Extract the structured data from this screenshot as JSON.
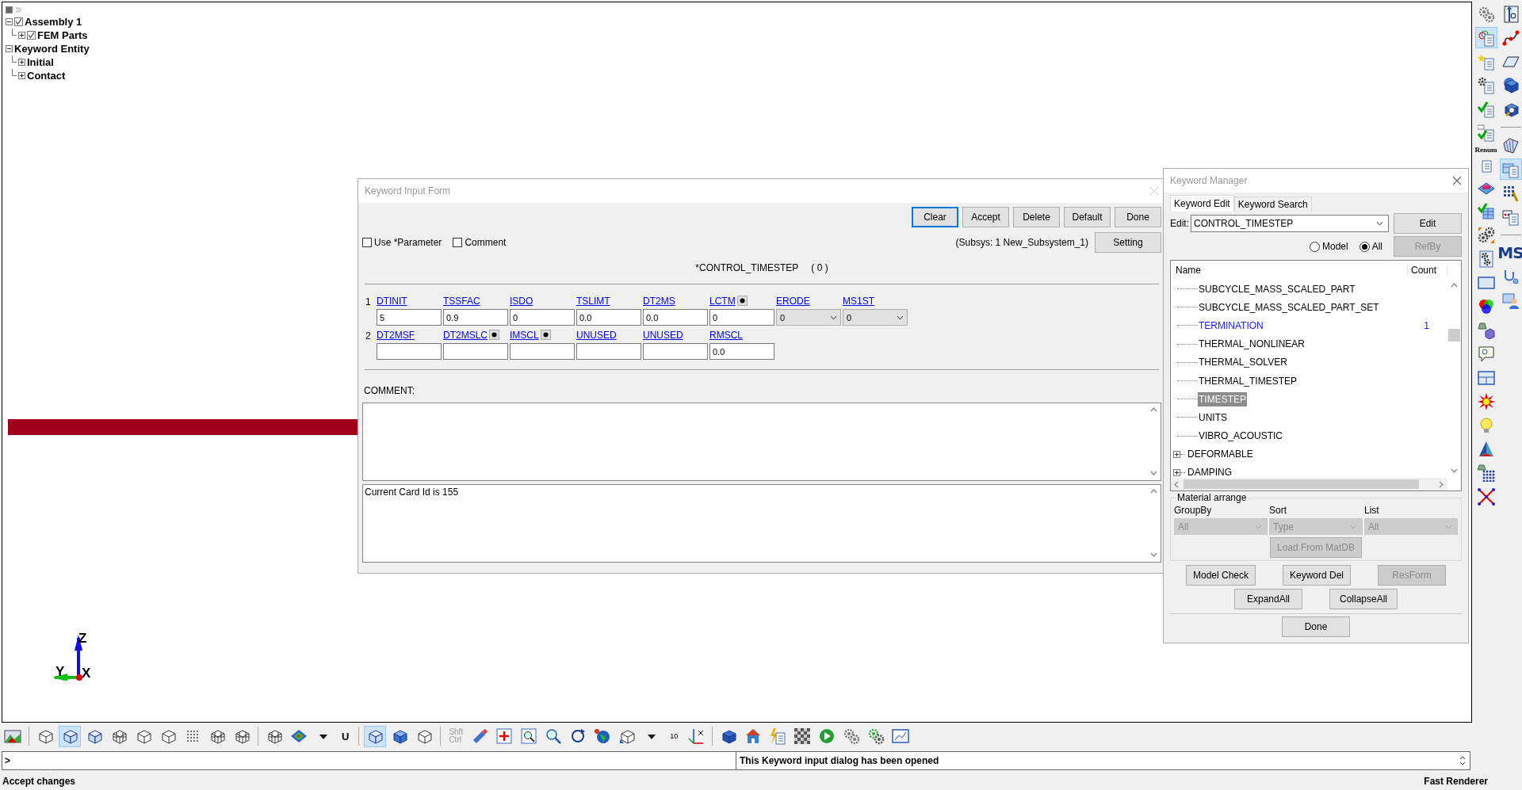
{
  "tree": [
    {
      "label": "Assembly 1",
      "checked": true,
      "expanded": true,
      "children": [
        {
          "label": "FEM Parts",
          "checked": true,
          "expanded": false
        }
      ]
    },
    {
      "label": "Keyword Entity",
      "expanded": true,
      "children": [
        {
          "label": "Initial",
          "expanded": false
        },
        {
          "label": "Contact",
          "expanded": false
        }
      ]
    }
  ],
  "axes": {
    "z": "Z",
    "y": "Y",
    "x": "X"
  },
  "input_form": {
    "title": "Keyword Input Form",
    "buttons": [
      {
        "label": "Clear",
        "focused": true
      },
      {
        "label": "Accept",
        "focused": false
      },
      {
        "label": "Delete",
        "focused": false
      },
      {
        "label": "Default",
        "focused": false
      },
      {
        "label": "Done",
        "focused": false
      }
    ],
    "options": [
      {
        "label": "Use *Parameter",
        "checked": false
      },
      {
        "label": "Comment",
        "checked": false
      }
    ],
    "subsystem": "(Subsys: 1 New_Subsystem_1)",
    "setting_button": "Setting",
    "keyword": "*CONTROL_TIMESTEP",
    "count": "( 0 )",
    "cards": [
      {
        "number": "1",
        "fields": [
          {
            "name": "DTINIT",
            "kind": "text",
            "value": "5"
          },
          {
            "name": "TSSFAC",
            "kind": "text",
            "value": "0.9"
          },
          {
            "name": "ISDO",
            "kind": "text",
            "value": "0"
          },
          {
            "name": "TSLIMT",
            "kind": "text",
            "value": "0.0"
          },
          {
            "name": "DT2MS",
            "kind": "text",
            "value": "0.0"
          },
          {
            "name": "LCTM",
            "kind": "text",
            "value": "0",
            "picker": true
          },
          {
            "name": "ERODE",
            "kind": "select",
            "value": "0"
          },
          {
            "name": "MS1ST",
            "kind": "select",
            "value": "0"
          }
        ]
      },
      {
        "number": "2",
        "fields": [
          {
            "name": "DT2MSF",
            "kind": "text"
          },
          {
            "name": "DT2MSLC",
            "kind": "text",
            "picker": true
          },
          {
            "name": "IMSCL",
            "kind": "text",
            "picker": true
          },
          {
            "name": "UNUSED",
            "kind": "text"
          },
          {
            "name": "UNUSED",
            "kind": "text"
          },
          {
            "name": "RMSCL",
            "kind": "text",
            "value": "0.0"
          }
        ]
      }
    ],
    "comment_label": "COMMENT:",
    "message": "Current Card Id is 155"
  },
  "keyword_manager": {
    "title": "Keyword Manager",
    "tabs": [
      {
        "label": "Keyword Edit",
        "selected": true
      },
      {
        "label": "Keyword Search",
        "selected": false
      }
    ],
    "edit_label": "Edit:",
    "edit_value": "CONTROL_TIMESTEP",
    "edit_button": "Edit",
    "radios": [
      {
        "label": "Model",
        "selected": false
      },
      {
        "label": "All",
        "selected": true
      }
    ],
    "refby_button": {
      "label": "RefBy",
      "disabled": true
    },
    "columns": [
      "Name",
      "Count"
    ],
    "rows": [
      {
        "kind": "leaf",
        "label": "SUBCYCLE_MASS_SCALED_PART",
        "used": false,
        "selected": false
      },
      {
        "kind": "leaf",
        "label": "SUBCYCLE_MASS_SCALED_PART_SET",
        "used": false,
        "selected": false
      },
      {
        "kind": "leaf",
        "label": "TERMINATION",
        "count": "1",
        "used": true,
        "selected": false
      },
      {
        "kind": "leaf",
        "label": "THERMAL_NONLINEAR",
        "used": false,
        "selected": false
      },
      {
        "kind": "leaf",
        "label": "THERMAL_SOLVER",
        "used": false,
        "selected": false
      },
      {
        "kind": "leaf",
        "label": "THERMAL_TIMESTEP",
        "used": false,
        "selected": false
      },
      {
        "kind": "leaf",
        "label": "TIMESTEP",
        "used": false,
        "selected": true
      },
      {
        "kind": "leaf",
        "label": "UNITS",
        "used": false,
        "selected": false
      },
      {
        "kind": "leaf",
        "label": "VIBRO_ACOUSTIC",
        "used": false,
        "selected": false
      },
      {
        "kind": "group",
        "label": "DEFORMABLE",
        "used": false,
        "selected": false
      },
      {
        "kind": "group",
        "label": "DAMPING",
        "used": false,
        "selected": false
      }
    ],
    "material_arrange": {
      "title": "Material arrange",
      "selects": [
        {
          "label": "GroupBy",
          "value": "All",
          "disabled": true
        },
        {
          "label": "Sort",
          "value": "Type",
          "disabled": true
        },
        {
          "label": "List",
          "value": "All",
          "disabled": true
        }
      ],
      "load_button": {
        "label": "Load From MatDB",
        "disabled": true
      }
    },
    "buttons": [
      {
        "label": "Model Check",
        "disabled": false
      },
      {
        "label": "Keyword Del",
        "disabled": false
      },
      {
        "label": "ResForm",
        "disabled": true
      },
      {
        "label": "ExpandAll",
        "disabled": false
      },
      {
        "label": "CollapseAll",
        "disabled": false
      }
    ],
    "done_button": "Done"
  },
  "side_toolbar": {
    "column_1": [
      {
        "kind": "tool",
        "selected": false
      },
      {
        "kind": "tool",
        "selected": true
      },
      {
        "kind": "tool",
        "selected": false
      },
      {
        "kind": "tool",
        "selected": false
      },
      {
        "kind": "tool",
        "selected": false
      },
      {
        "kind": "tool",
        "selected": false
      },
      {
        "kind": "label",
        "label": "Renum"
      },
      {
        "kind": "tool",
        "selected": false
      },
      {
        "kind": "tool",
        "selected": false
      },
      {
        "kind": "tool",
        "selected": false
      },
      {
        "kind": "tool",
        "selected": false
      },
      {
        "kind": "tool",
        "selected": false
      },
      {
        "kind": "tool",
        "selected": false
      },
      {
        "kind": "tool",
        "selected": false
      },
      {
        "kind": "tool",
        "selected": false
      },
      {
        "kind": "tool",
        "selected": false
      },
      {
        "kind": "tool",
        "selected": false
      },
      {
        "kind": "tool",
        "selected": false
      },
      {
        "kind": "tool",
        "selected": false
      },
      {
        "kind": "tool",
        "selected": false
      },
      {
        "kind": "tool",
        "selected": false
      },
      {
        "kind": "tool",
        "selected": false
      }
    ],
    "column_2": [
      {
        "kind": "tool",
        "selected": false
      },
      {
        "kind": "tool",
        "selected": false
      },
      {
        "kind": "tool",
        "selected": false
      },
      {
        "kind": "tool",
        "selected": false
      },
      {
        "kind": "tool",
        "selected": false
      },
      {
        "kind": "separator"
      },
      {
        "kind": "tool",
        "selected": false
      },
      {
        "kind": "tool",
        "selected": true
      },
      {
        "kind": "tool",
        "selected": false
      },
      {
        "kind": "tool",
        "selected": false
      },
      {
        "kind": "separator"
      },
      {
        "kind": "label",
        "label": "MS"
      },
      {
        "kind": "tool",
        "selected": false
      },
      {
        "kind": "tool",
        "selected": false
      }
    ]
  },
  "bottom_toolbar": [
    {
      "kind": "tool",
      "selected": false
    },
    {
      "kind": "separator"
    },
    {
      "kind": "tool",
      "selected": false
    },
    {
      "kind": "tool",
      "selected": true
    },
    {
      "kind": "tool",
      "selected": false
    },
    {
      "kind": "tool",
      "selected": false
    },
    {
      "kind": "tool",
      "selected": false
    },
    {
      "kind": "tool",
      "selected": false
    },
    {
      "kind": "tool",
      "selected": false
    },
    {
      "kind": "tool",
      "selected": false
    },
    {
      "kind": "tool",
      "selected": false
    },
    {
      "kind": "separator"
    },
    {
      "kind": "tool",
      "selected": false
    },
    {
      "kind": "tool",
      "selected": false
    },
    {
      "kind": "tool",
      "selected": false
    },
    {
      "kind": "label",
      "label": "U"
    },
    {
      "kind": "separator"
    },
    {
      "kind": "tool",
      "selected": true
    },
    {
      "kind": "tool",
      "selected": false
    },
    {
      "kind": "tool",
      "selected": false
    },
    {
      "kind": "separator"
    },
    {
      "kind": "keys",
      "labels": [
        "Shft",
        "Ctrl"
      ],
      "disabled": true
    },
    {
      "kind": "tool",
      "selected": false
    },
    {
      "kind": "tool",
      "selected": false
    },
    {
      "kind": "tool",
      "selected": false
    },
    {
      "kind": "tool",
      "selected": false
    },
    {
      "kind": "tool",
      "selected": false
    },
    {
      "kind": "tool",
      "selected": false
    },
    {
      "kind": "tool",
      "selected": false
    },
    {
      "kind": "tool",
      "selected": false
    },
    {
      "kind": "label",
      "label": "10"
    },
    {
      "kind": "tool",
      "selected": false
    },
    {
      "kind": "separator"
    },
    {
      "kind": "tool",
      "selected": false
    },
    {
      "kind": "tool",
      "selected": false
    },
    {
      "kind": "tool",
      "selected": false
    },
    {
      "kind": "tool",
      "selected": false
    },
    {
      "kind": "tool",
      "selected": false
    },
    {
      "kind": "tool",
      "selected": false
    },
    {
      "kind": "tool",
      "selected": false
    },
    {
      "kind": "tool",
      "selected": false
    }
  ],
  "command_line": {
    "prompt": ">",
    "message": "This Keyword input dialog has been opened"
  },
  "status_bar": {
    "left": "Accept changes",
    "right": "Fast Renderer"
  }
}
